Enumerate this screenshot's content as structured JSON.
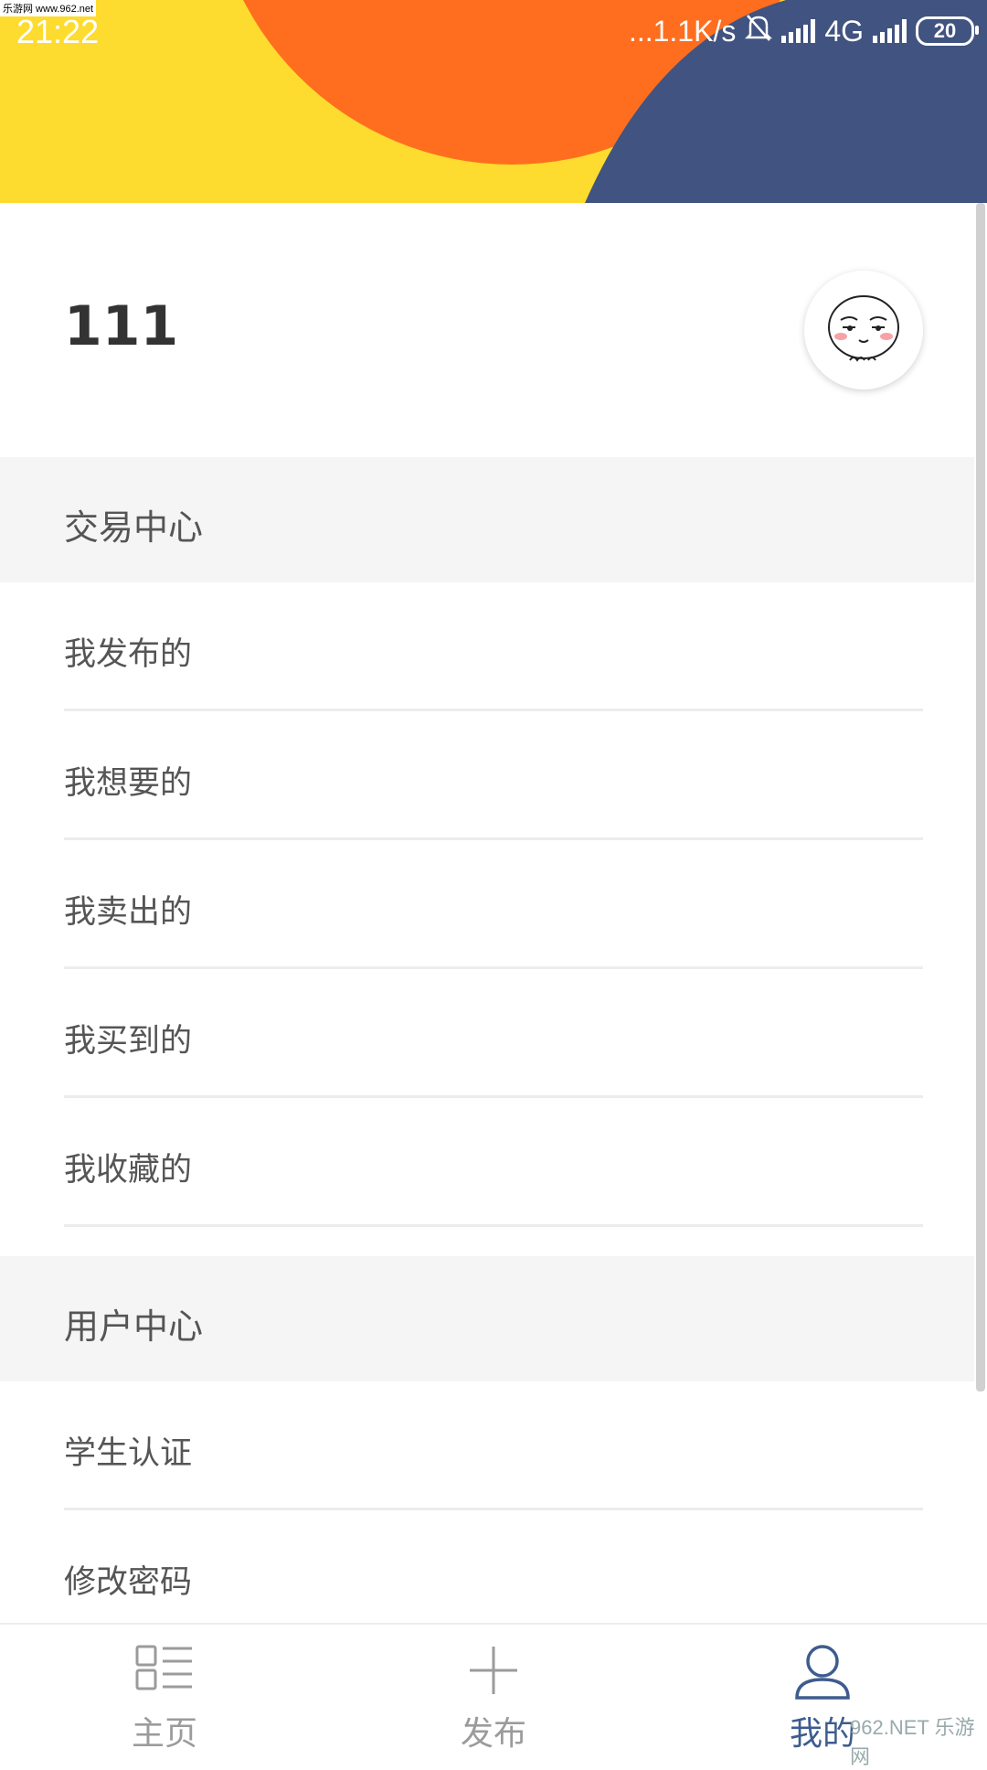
{
  "status_bar": {
    "time": "21:22",
    "net_speed": "...1.1K/s",
    "network": "4G",
    "battery": "20",
    "watermark": "乐游网 www.962.net"
  },
  "header": {
    "colors": {
      "yellow": "#fedb2f",
      "orange": "#ff6e1f",
      "navy": "#415380"
    }
  },
  "profile": {
    "username": "111",
    "avatar_icon": "face-avatar-icon"
  },
  "sections": [
    {
      "title": "交易中心",
      "items": [
        "我发布的",
        "我想要的",
        "我卖出的",
        "我买到的",
        "我收藏的"
      ]
    },
    {
      "title": "用户中心",
      "items": [
        "学生认证",
        "修改密码"
      ]
    }
  ],
  "bottom_nav": {
    "items": [
      {
        "label": "主页",
        "icon": "home-list-icon",
        "active": false
      },
      {
        "label": "发布",
        "icon": "plus-icon",
        "active": false
      },
      {
        "label": "我的",
        "icon": "user-icon",
        "active": true
      }
    ],
    "active_color": "#3e5c8e"
  },
  "watermark_bottom": "962.NET 乐游网"
}
